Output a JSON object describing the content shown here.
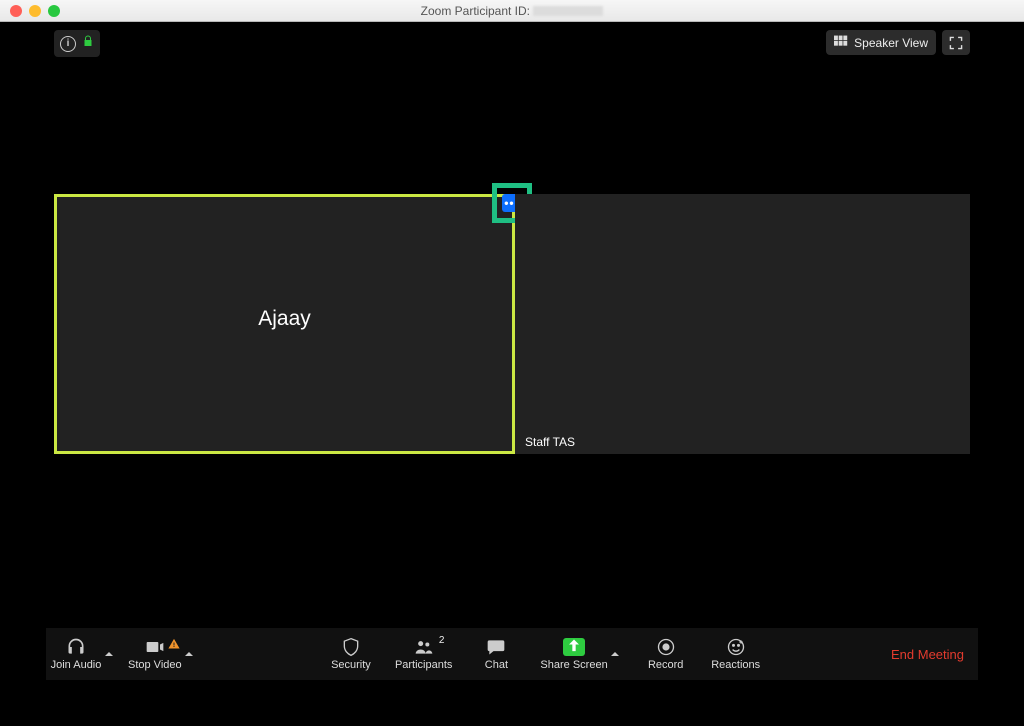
{
  "window": {
    "title_prefix": "Zoom Participant ID:"
  },
  "topbar": {
    "speaker_view_label": "Speaker View"
  },
  "participants": [
    {
      "name": "Ajaay"
    },
    {
      "name": "Staff TAS"
    }
  ],
  "badges": {
    "participant_count": "2"
  },
  "toolbar": {
    "join_audio": "Join Audio",
    "stop_video": "Stop Video",
    "security": "Security",
    "participants": "Participants",
    "chat": "Chat",
    "share_screen": "Share Screen",
    "record": "Record",
    "reactions": "Reactions",
    "end_meeting": "End Meeting"
  },
  "icons": {
    "info": "info-icon",
    "lock": "lock-icon",
    "gallery": "gallery-icon",
    "fullscreen": "fullscreen-icon",
    "more": "more-icon",
    "headphones": "headphones-icon",
    "video": "video-icon",
    "shield": "shield-icon",
    "people": "people-icon",
    "chat": "chat-icon",
    "share": "share-icon",
    "record": "record-icon",
    "reactions": "reactions-icon",
    "chevron_up": "chevron-up-icon",
    "warning": "warning-icon"
  },
  "colors": {
    "highlight_border": "#1fbf83",
    "active_tile_border": "#cbe843",
    "share_green": "#2ecc40",
    "end_red": "#e33b2e",
    "more_blue": "#0d6efd"
  }
}
